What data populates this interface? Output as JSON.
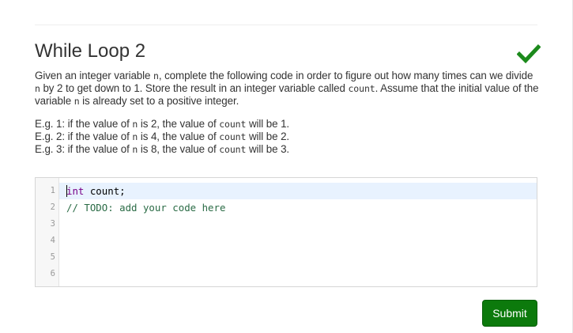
{
  "problem": {
    "title": "While Loop 2",
    "status_icon": "check-icon",
    "status_color": "#1c8a1c",
    "description": {
      "t1": "Given an integer variable ",
      "c1": "n",
      "t2": ", complete the following code in order to figure out how many times can we divide ",
      "c2": "n",
      "t3": " by 2 to get down to 1. Store the result in an integer variable called ",
      "c3": "count",
      "t4": ". Assume that the initial value of the variable ",
      "c4": "n",
      "t5": " is already set to a positive integer."
    },
    "examples": [
      {
        "prefix": "E.g. 1: if the value of ",
        "var1": "n",
        "mid": " is 2, the value of ",
        "var2": "count",
        "suffix": " will be 1."
      },
      {
        "prefix": "E.g. 2: if the value of ",
        "var1": "n",
        "mid": " is 4, the value of ",
        "var2": "count",
        "suffix": " will be 2."
      },
      {
        "prefix": "E.g. 3: if the value of ",
        "var1": "n",
        "mid": " is 8, the value of ",
        "var2": "count",
        "suffix": " will be 3."
      }
    ]
  },
  "editor": {
    "line_numbers": [
      "1",
      "2",
      "3",
      "4",
      "5",
      "6"
    ],
    "lines": [
      {
        "keyword": "int",
        "rest": " count;"
      },
      {
        "comment": "// TODO: add your code here"
      }
    ],
    "active_line_color": "#e8f2fe"
  },
  "actions": {
    "submit_label": "Submit",
    "submit_color": "#0c7a0c"
  }
}
